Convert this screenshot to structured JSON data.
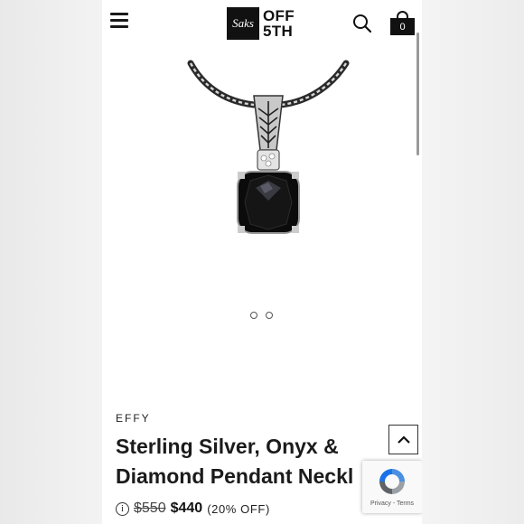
{
  "header": {
    "logo_mark": "Saks",
    "logo_line1": "OFF",
    "logo_line2": "5TH",
    "cart_count": "0",
    "icons": [
      "menu-icon",
      "search-icon",
      "shopping-bag-icon"
    ]
  },
  "gallery": {
    "image_alt": "Sterling Silver, Onyx & Diamond Pendant Necklace",
    "slides": 2,
    "active_slide": 1
  },
  "product": {
    "brand": "EFFY",
    "title_line1": "Sterling Silver, Onyx &",
    "title_line2": "Diamond Pendant Neckl",
    "price_original": "$550",
    "price_sale": "$440",
    "discount": "(20% OFF)",
    "info_icon": "i"
  },
  "recaptcha": {
    "privacy": "Privacy",
    "separator": " - ",
    "terms": "Terms"
  },
  "colors": {
    "text": "#1b1b1b",
    "logo_bg": "#111111",
    "stone": "#0b0b0b",
    "silver": "#b9b9b9"
  }
}
